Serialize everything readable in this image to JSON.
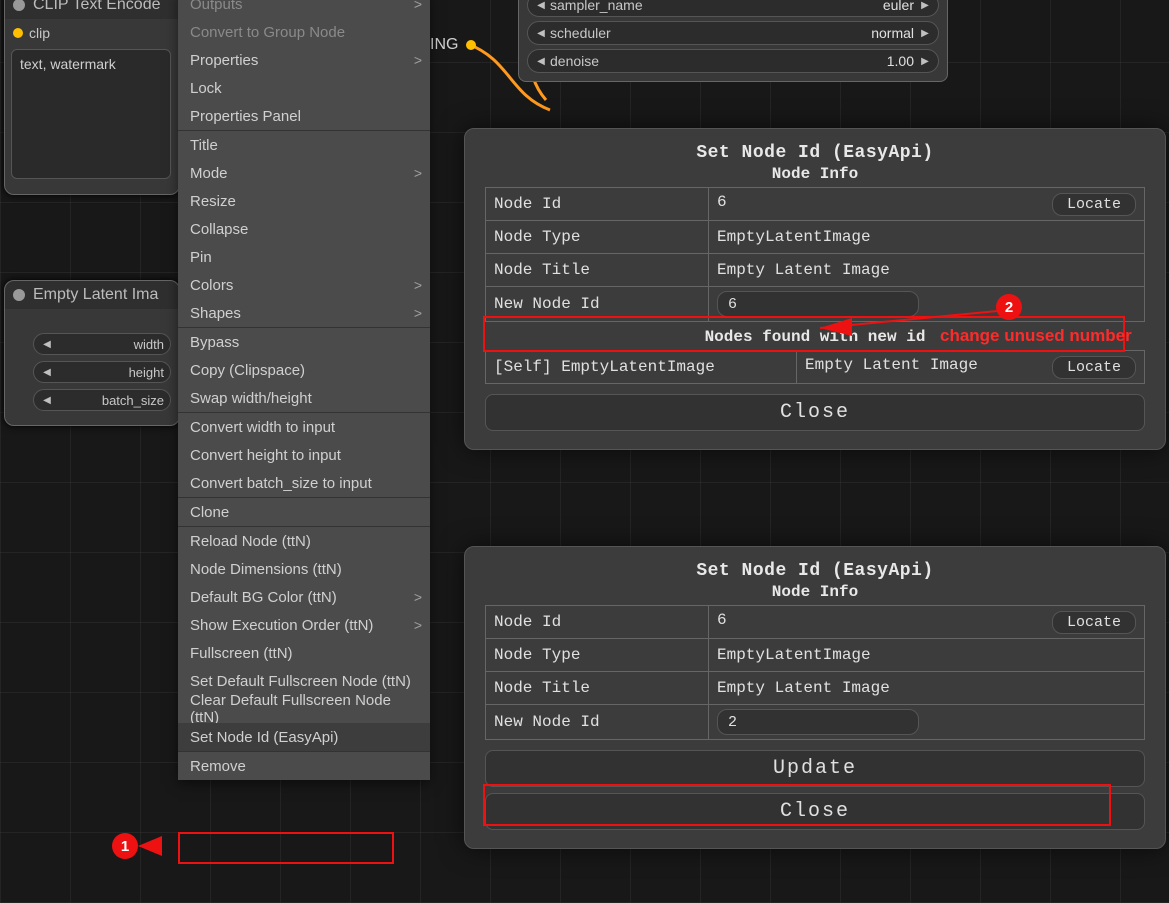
{
  "sampler": {
    "rows": [
      {
        "label": "sampler_name",
        "value": "euler"
      },
      {
        "label": "scheduler",
        "value": "normal"
      },
      {
        "label": "denoise",
        "value": "1.00"
      }
    ]
  },
  "clipNode": {
    "title": "CLIP Text Encode",
    "port": "clip",
    "prompt": "text, watermark"
  },
  "latentNode": {
    "title": "Empty Latent Ima",
    "params": [
      "width",
      "height",
      "batch_size"
    ]
  },
  "ingBadge": "ING",
  "contextMenu": {
    "groups": [
      {
        "items": [
          {
            "label": "Outputs",
            "sub": true,
            "disabled": true
          },
          {
            "label": "Convert to Group Node",
            "disabled": true
          },
          {
            "label": "Properties",
            "sub": true
          },
          {
            "label": "Lock"
          },
          {
            "label": "Properties Panel"
          }
        ]
      },
      {
        "items": [
          {
            "label": "Title"
          },
          {
            "label": "Mode",
            "sub": true
          },
          {
            "label": "Resize"
          },
          {
            "label": "Collapse"
          },
          {
            "label": "Pin"
          },
          {
            "label": "Colors",
            "sub": true
          },
          {
            "label": "Shapes",
            "sub": true
          }
        ]
      },
      {
        "items": [
          {
            "label": "Bypass"
          },
          {
            "label": "Copy (Clipspace)"
          },
          {
            "label": "Swap width/height"
          }
        ]
      },
      {
        "items": [
          {
            "label": "Convert width to input"
          },
          {
            "label": "Convert height to input"
          },
          {
            "label": "Convert batch_size to input"
          }
        ]
      },
      {
        "items": [
          {
            "label": "Clone"
          }
        ]
      },
      {
        "items": [
          {
            "label": "Reload Node (ttN)"
          },
          {
            "label": "Node Dimensions (ttN)"
          },
          {
            "label": "Default BG Color (ttN)",
            "sub": true
          },
          {
            "label": "Show Execution Order (ttN)",
            "sub": true
          },
          {
            "label": "Fullscreen (ttN)"
          },
          {
            "label": "Set Default Fullscreen Node (ttN)"
          },
          {
            "label": "Clear Default Fullscreen Node (ttN)"
          },
          {
            "label": "Set Node Id (EasyApi)",
            "selected": true
          }
        ]
      },
      {
        "items": [
          {
            "label": "Remove"
          }
        ]
      }
    ]
  },
  "dialog1": {
    "title": "Set Node Id (EasyApi)",
    "section": "Node Info",
    "rows": {
      "nodeId": {
        "label": "Node Id",
        "value": "6",
        "locate": "Locate"
      },
      "nodeType": {
        "label": "Node Type",
        "value": "EmptyLatentImage"
      },
      "nodeTitle": {
        "label": "Node Title",
        "value": "Empty Latent Image"
      },
      "newId": {
        "label": "New Node Id",
        "value": "6"
      }
    },
    "foundTitle": "Nodes found with new id",
    "found": {
      "self": "[Self] EmptyLatentImage",
      "name": "Empty Latent Image",
      "locate": "Locate"
    },
    "close": "Close"
  },
  "dialog2": {
    "title": "Set Node Id (EasyApi)",
    "section": "Node Info",
    "rows": {
      "nodeId": {
        "label": "Node Id",
        "value": "6",
        "locate": "Locate"
      },
      "nodeType": {
        "label": "Node Type",
        "value": "EmptyLatentImage"
      },
      "nodeTitle": {
        "label": "Node Title",
        "value": "Empty Latent Image"
      },
      "newId": {
        "label": "New Node Id",
        "value": "2"
      }
    },
    "update": "Update",
    "close": "Close"
  },
  "annotations": {
    "marker1": "1",
    "marker2": "2",
    "changeText": "change unused number"
  }
}
